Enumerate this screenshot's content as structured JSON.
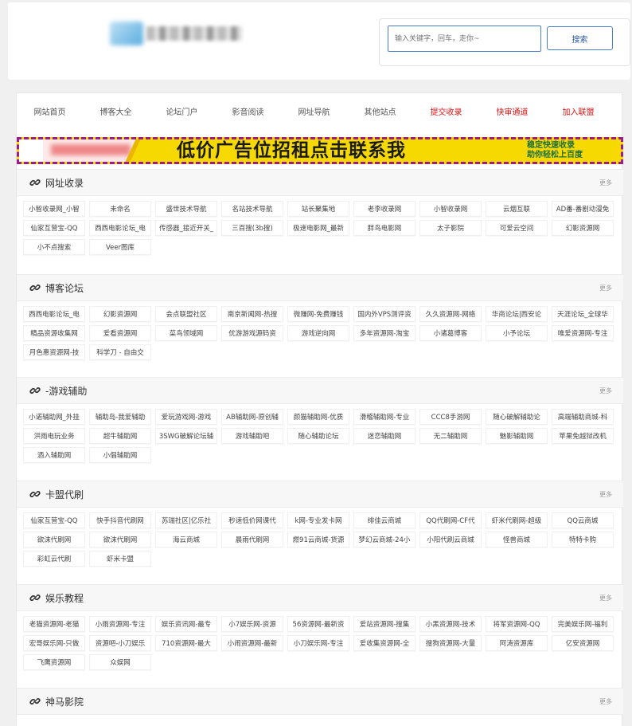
{
  "search": {
    "placeholder": "输入关键字，回车，走你~",
    "button": "搜索"
  },
  "nav": [
    {
      "label": "网站首页",
      "red": false
    },
    {
      "label": "博客大全",
      "red": false
    },
    {
      "label": "论坛门户",
      "red": false
    },
    {
      "label": "影音阅读",
      "red": false
    },
    {
      "label": "网址导航",
      "red": false
    },
    {
      "label": "其他站点",
      "red": false
    },
    {
      "label": "提交收录",
      "red": true
    },
    {
      "label": "快审通道",
      "red": true
    },
    {
      "label": "加入联盟",
      "red": true
    }
  ],
  "banner": {
    "title": "低价广告位招租点击联系我",
    "sub1": "稳定快速收录",
    "sub2": "助你轻松上百度"
  },
  "more_label": "更多",
  "sections": [
    {
      "title": "网址收录",
      "items": [
        "小智收录网_小智",
        "未命名",
        "盛世技术导航",
        "名站技术导航",
        "站长聚集地",
        "老李收录网",
        "小智收录网",
        "云烟互联",
        "AD番-番剧动漫免",
        "仙家互营宝-QQ",
        "西西电影论坛_电",
        "传感器_接近开关_",
        "三百搜(3b搜)",
        "极速电影网_最新",
        "胖鸟电影网",
        "太子影院",
        "可爱云空间",
        "幻影资源网",
        "小不点搜索",
        "Veer图库"
      ]
    },
    {
      "title": "博客论坛",
      "items": [
        "西西电影论坛_电",
        "幻影资源网",
        "会点联盟社区",
        "南京新闻网-热搜",
        "微赚网-免费赚钱",
        "国内外VPS测评资",
        "久久资源网-网络",
        "华商论坛|西安论",
        "天涯论坛_全球华",
        "精品资源收集网",
        "爱看资源网",
        "菜鸟领域网",
        "优游游戏源码资",
        "游戏逆向网",
        "多年资源网-淘宝",
        "小诸葛博客",
        "小予论坛",
        "唯爱资源网-专注",
        "月色惠资源网-技",
        "科学刀 - 自由交"
      ]
    },
    {
      "title": "-游戏辅助",
      "items": [
        "小诺辅助网_外挂",
        "辅助岛-我爱辅助",
        "爱玩游戏网-游戏",
        "AB辅助网-原创辅",
        "颜猫辅助网-优质",
        "滑稽辅助网-专业",
        "CCC8手游网",
        "随心破解辅助论",
        "高端辅助商城-科",
        "洪雨电玩业务",
        "超牛辅助网",
        "3SWG破解论坛辅",
        "游戏辅助吧",
        "随心辅助论坛",
        "迷恋辅助网",
        "无二辅助网",
        "魅影辅助网",
        "苹果免越狱改机",
        "酒入辅助网",
        "小倡辅助网"
      ]
    },
    {
      "title": "卡盟代刷",
      "items": [
        "仙家互营宝-QQ",
        "快手抖音代刷网",
        "苏瑞社区|亿乐社",
        "秒速低价网课代",
        "k网-专业发卡网",
        "绯佳云商城",
        "QQ代刷网-CF代",
        "虾米代刷网-超级",
        "QQ云商城",
        "欲沫代刷网",
        "欲沫代刷网",
        "海云商城",
        "晨雨代刷网",
        "燃91云商城-货源",
        "梦幻云商城-24小",
        "小阳代刷云商城",
        "怪兽商城",
        "特特卡购",
        "彩虹云代刷",
        "虾米卡盟"
      ]
    },
    {
      "title": "娱乐教程",
      "items": [
        "老猫资源网-老猫",
        "小雨资源网-专注",
        "娱乐资讯网-最专",
        "小7娱乐网-资源",
        "56资源网-最新资",
        "爱站资源网-搜集",
        "小黑资源网-技术",
        "将军资源网-QQ",
        "完美娱乐网-福利",
        "宏哥娱乐网-只做",
        "资源吧-小刀娱乐",
        "710资源网-最大",
        "小闹资源网-最新",
        "小刀娱乐网-专注",
        "爱收集资源网-全",
        "搜狗资源网-大量",
        "阿涛资源库",
        "亿安资源网",
        "飞鹰资源网",
        "众娱网"
      ]
    },
    {
      "title": "神马影院",
      "items": []
    }
  ]
}
